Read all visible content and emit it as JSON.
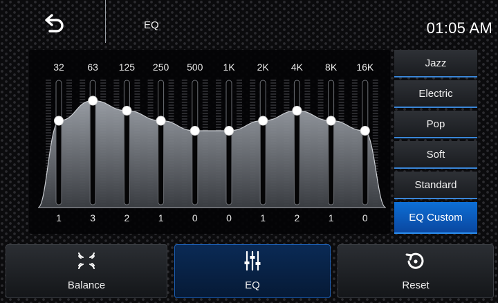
{
  "header": {
    "title": "EQ",
    "time": "01:05 AM"
  },
  "eq": {
    "bands": [
      {
        "freq": "32",
        "level": 1
      },
      {
        "freq": "63",
        "level": 3
      },
      {
        "freq": "125",
        "level": 2
      },
      {
        "freq": "250",
        "level": 1
      },
      {
        "freq": "500",
        "level": 0
      },
      {
        "freq": "1K",
        "level": 0
      },
      {
        "freq": "2K",
        "level": 1
      },
      {
        "freq": "4K",
        "level": 2
      },
      {
        "freq": "8K",
        "level": 1
      },
      {
        "freq": "16K",
        "level": 0
      }
    ]
  },
  "presets": [
    "Jazz",
    "Electric",
    "Pop",
    "Soft",
    "Standard",
    "EQ Custom"
  ],
  "active_preset": "EQ Custom",
  "bottom_nav": [
    {
      "label": "Balance",
      "icon": "balance-icon"
    },
    {
      "label": "EQ",
      "icon": "eq-sliders-icon"
    },
    {
      "label": "Reset",
      "icon": "reset-icon"
    }
  ],
  "active_tab": "EQ",
  "colors": {
    "accent": "#0a6fd6",
    "active_bg": "#0a47a0"
  }
}
